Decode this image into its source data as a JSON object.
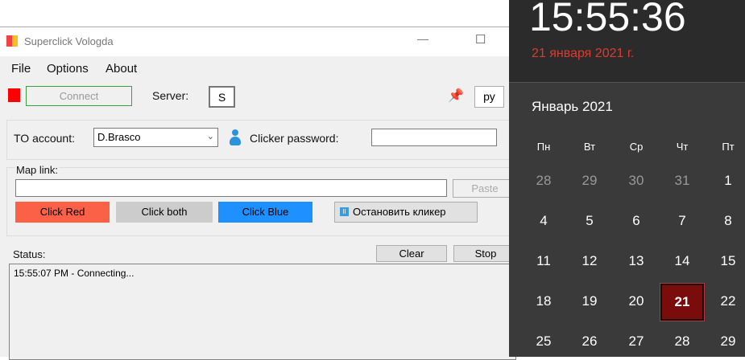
{
  "window": {
    "title": "Superclick Vologda",
    "minimize": "—",
    "maximize": "☐"
  },
  "menu": [
    "File",
    "Options",
    "About"
  ],
  "toolbar": {
    "connect": "Connect",
    "server_label": "Server:",
    "server_value": "S",
    "lang_value": "ру",
    "status_color": "#ff0000"
  },
  "account": {
    "label": "TO account:",
    "value": "D.Brasco",
    "password_label": "Clicker password:"
  },
  "map": {
    "label": "Map link:",
    "value": "",
    "paste": "Paste",
    "click_red": "Click Red",
    "click_both": "Click both",
    "click_blue": "Click Blue",
    "stop_clicker": "Остановить кликер"
  },
  "status": {
    "label": "Status:",
    "clear": "Clear",
    "stop": "Stop",
    "log": "15:55:07 PM - Connecting..."
  },
  "calendar": {
    "time": "15:55:36",
    "date": "21 января 2021 г.",
    "month": "Январь 2021",
    "weekdays": [
      "Пн",
      "Вт",
      "Ср",
      "Чт",
      "Пт"
    ],
    "weeks": [
      [
        "28",
        "29",
        "30",
        "31",
        "1"
      ],
      [
        "4",
        "5",
        "6",
        "7",
        "8"
      ],
      [
        "11",
        "12",
        "13",
        "14",
        "15"
      ],
      [
        "18",
        "19",
        "20",
        "21",
        "22"
      ],
      [
        "25",
        "26",
        "27",
        "28",
        "29"
      ]
    ],
    "today": "21"
  }
}
